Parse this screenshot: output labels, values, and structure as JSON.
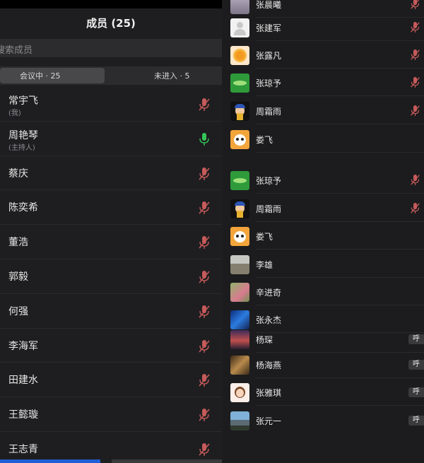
{
  "header": {
    "title": "成员 (25)"
  },
  "search": {
    "placeholder": "搜索成员"
  },
  "tabs": [
    {
      "label": "会议中 · 25",
      "active": true
    },
    {
      "label": "未进入 · 5",
      "active": false
    }
  ],
  "members": [
    {
      "name": "常宇飞",
      "role": "(我)",
      "mic": "muted"
    },
    {
      "name": "周艳琴",
      "role": "(主持人)",
      "mic": "active"
    },
    {
      "name": "蔡庆",
      "role": "",
      "mic": "muted"
    },
    {
      "name": "陈奕希",
      "role": "",
      "mic": "muted"
    },
    {
      "name": "董浩",
      "role": "",
      "mic": "muted"
    },
    {
      "name": "郭毅",
      "role": "",
      "mic": "muted"
    },
    {
      "name": "何强",
      "role": "",
      "mic": "muted"
    },
    {
      "name": "李海军",
      "role": "",
      "mic": "muted"
    },
    {
      "name": "田建水",
      "role": "",
      "mic": "muted"
    },
    {
      "name": "王懿璇",
      "role": "",
      "mic": "muted"
    },
    {
      "name": "王志青",
      "role": "",
      "mic": "muted"
    }
  ],
  "right_list": [
    {
      "name": "张晨曦",
      "avatar": "avatar-photo",
      "mic": "muted",
      "call": ""
    },
    {
      "name": "张建军",
      "avatar": "avatar-default",
      "mic": "muted",
      "call": ""
    },
    {
      "name": "张露凡",
      "avatar": "avatar-sun",
      "mic": "muted",
      "call": ""
    },
    {
      "name": "张琼予",
      "avatar": "avatar-green",
      "mic": "muted",
      "call": ""
    },
    {
      "name": "周霜雨",
      "avatar": "avatar-portrait",
      "mic": "muted",
      "call": ""
    },
    {
      "name": "娄飞",
      "avatar": "avatar-panda",
      "mic": "",
      "call": ""
    },
    {
      "name": "张琼予",
      "avatar": "avatar-green",
      "mic": "muted",
      "call": ""
    },
    {
      "name": "周霜雨",
      "avatar": "avatar-portrait",
      "mic": "muted",
      "call": ""
    },
    {
      "name": "娄飞",
      "avatar": "avatar-panda",
      "mic": "",
      "call": ""
    },
    {
      "name": "李雄",
      "avatar": "avatar-landscape",
      "mic": "",
      "call": ""
    },
    {
      "name": "辛进奇",
      "avatar": "avatar-flowers",
      "mic": "",
      "call": ""
    },
    {
      "name": "张永杰",
      "avatar": "avatar-blue-abstract",
      "mic": "",
      "call": ""
    },
    {
      "name": "杨琛",
      "avatar": "avatar-sunset",
      "mic": "",
      "call": "呼"
    },
    {
      "name": "杨海燕",
      "avatar": "avatar-horse",
      "mic": "",
      "call": "呼"
    },
    {
      "name": "张雅琪",
      "avatar": "avatar-cartoon-girl",
      "mic": "",
      "call": "呼"
    },
    {
      "name": "张元一",
      "avatar": "avatar-mountain",
      "mic": "",
      "call": "呼"
    }
  ],
  "colors": {
    "accent": "#1f5fd6",
    "mic_active": "#34c759",
    "mic_muted": "#c65a5a"
  }
}
